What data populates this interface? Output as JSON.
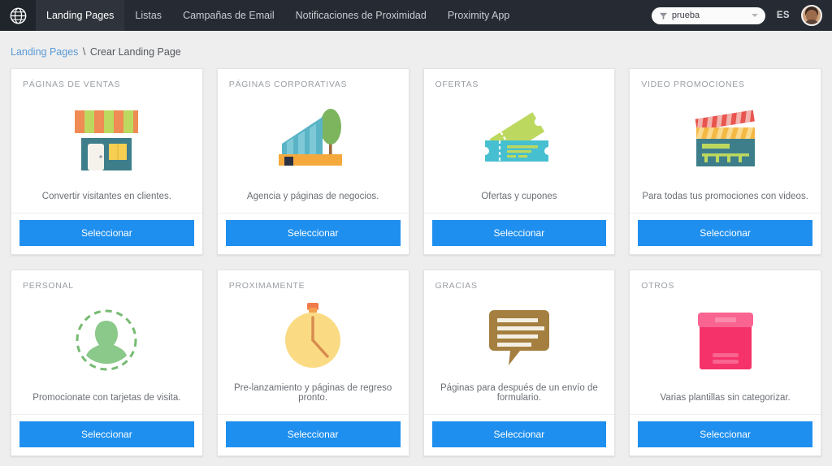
{
  "navbar": {
    "brand_icon": "globe-icon",
    "links": [
      {
        "label": "Landing Pages",
        "active": true
      },
      {
        "label": "Listas",
        "active": false
      },
      {
        "label": "Campañas de Email",
        "active": false
      },
      {
        "label": "Notificaciones de Proximidad",
        "active": false
      },
      {
        "label": "Proximity App",
        "active": false
      }
    ],
    "search": {
      "value": "prueba",
      "placeholder": "prueba",
      "icon": "filter-icon",
      "caret": "chevron-down-icon"
    },
    "language": "ES",
    "avatar": "user-avatar"
  },
  "breadcrumb": {
    "link": "Landing Pages",
    "separator": "\\",
    "current": "Crear Landing Page"
  },
  "colors": {
    "navbar_bg": "#262b33",
    "page_bg": "#eeeeee",
    "accent_button": "#1e8fef",
    "link": "#5b9bd5",
    "card_bg": "#ffffff",
    "title_text": "#9a9ea4",
    "desc_text": "#6b6f76"
  },
  "button_label": "Seleccionar",
  "cards": [
    {
      "title": "PÁGINAS DE VENTAS",
      "description": "Convertir visitantes en clientes.",
      "icon": "storefront-icon",
      "button": "Seleccionar"
    },
    {
      "title": "PÁGINAS CORPORATIVAS",
      "description": "Agencia y páginas de negocios.",
      "icon": "office-building-icon",
      "button": "Seleccionar"
    },
    {
      "title": "OFERTAS",
      "description": "Ofertas y cupones",
      "icon": "coupon-tickets-icon",
      "button": "Seleccionar"
    },
    {
      "title": "VIDEO PROMOCIONES",
      "description": "Para todas tus promociones con videos.",
      "icon": "clapperboard-icon",
      "button": "Seleccionar"
    },
    {
      "title": "PERSONAL",
      "description": "Promocionate con tarjetas de visita.",
      "icon": "person-avatar-icon",
      "button": "Seleccionar"
    },
    {
      "title": "PROXIMAMENTE",
      "description": "Pre-lanzamiento y páginas de regreso pronto.",
      "icon": "stopwatch-icon",
      "button": "Seleccionar"
    },
    {
      "title": "GRACIAS",
      "description": "Páginas para después de un envío de formulario.",
      "icon": "speech-bubble-icon",
      "button": "Seleccionar"
    },
    {
      "title": "OTROS",
      "description": "Varias plantillas sin categorizar.",
      "icon": "storage-box-icon",
      "button": "Seleccionar"
    }
  ]
}
